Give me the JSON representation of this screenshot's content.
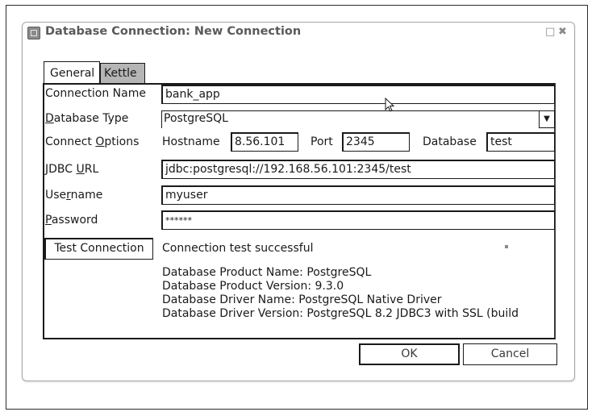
{
  "dialog": {
    "title": "Database Connection: New Connection",
    "window_buttons": {
      "maximize": "□",
      "close": "✖"
    }
  },
  "tabs": [
    {
      "label": "General",
      "active": true
    },
    {
      "label": "Kettle",
      "active": false
    }
  ],
  "form": {
    "connection_name": {
      "label": "Connection Name",
      "value": "bank_app"
    },
    "database_type": {
      "label_accel": "D",
      "label_rest": "atabase Type",
      "value": "PostgreSQL"
    },
    "connect_options": {
      "label_pre": "Connect ",
      "label_accel": "O",
      "label_post": "ptions",
      "hostname_label": "Hostname",
      "hostname_value": "8.56.101",
      "port_label": "Port",
      "port_value": "2345",
      "database_label": "Database",
      "database_value": "test"
    },
    "jdbc_url": {
      "label_pre": "JDBC ",
      "label_accel": "U",
      "label_post": "RL",
      "value": "jdbc:postgresql://192.168.56.101:2345/test"
    },
    "username": {
      "label_pre": "Use",
      "label_accel": "r",
      "label_post": "name",
      "value": "myuser"
    },
    "password": {
      "label_accel": "P",
      "label_rest": "assword",
      "value": "******"
    }
  },
  "test": {
    "button_label": "Test Connection",
    "status": "Connection test successful",
    "details": [
      "Database Product Name: PostgreSQL",
      "Database Product Version: 9.3.0",
      "Database Driver Name: PostgreSQL Native Driver",
      "Database Driver Version: PostgreSQL 8.2 JDBC3 with SSL (build"
    ]
  },
  "buttons": {
    "ok": "OK",
    "cancel": "Cancel"
  },
  "colors": {
    "border": "#1a1a1a",
    "inactive_tab": "#b5b5b5",
    "title": "#5a5a5a"
  }
}
